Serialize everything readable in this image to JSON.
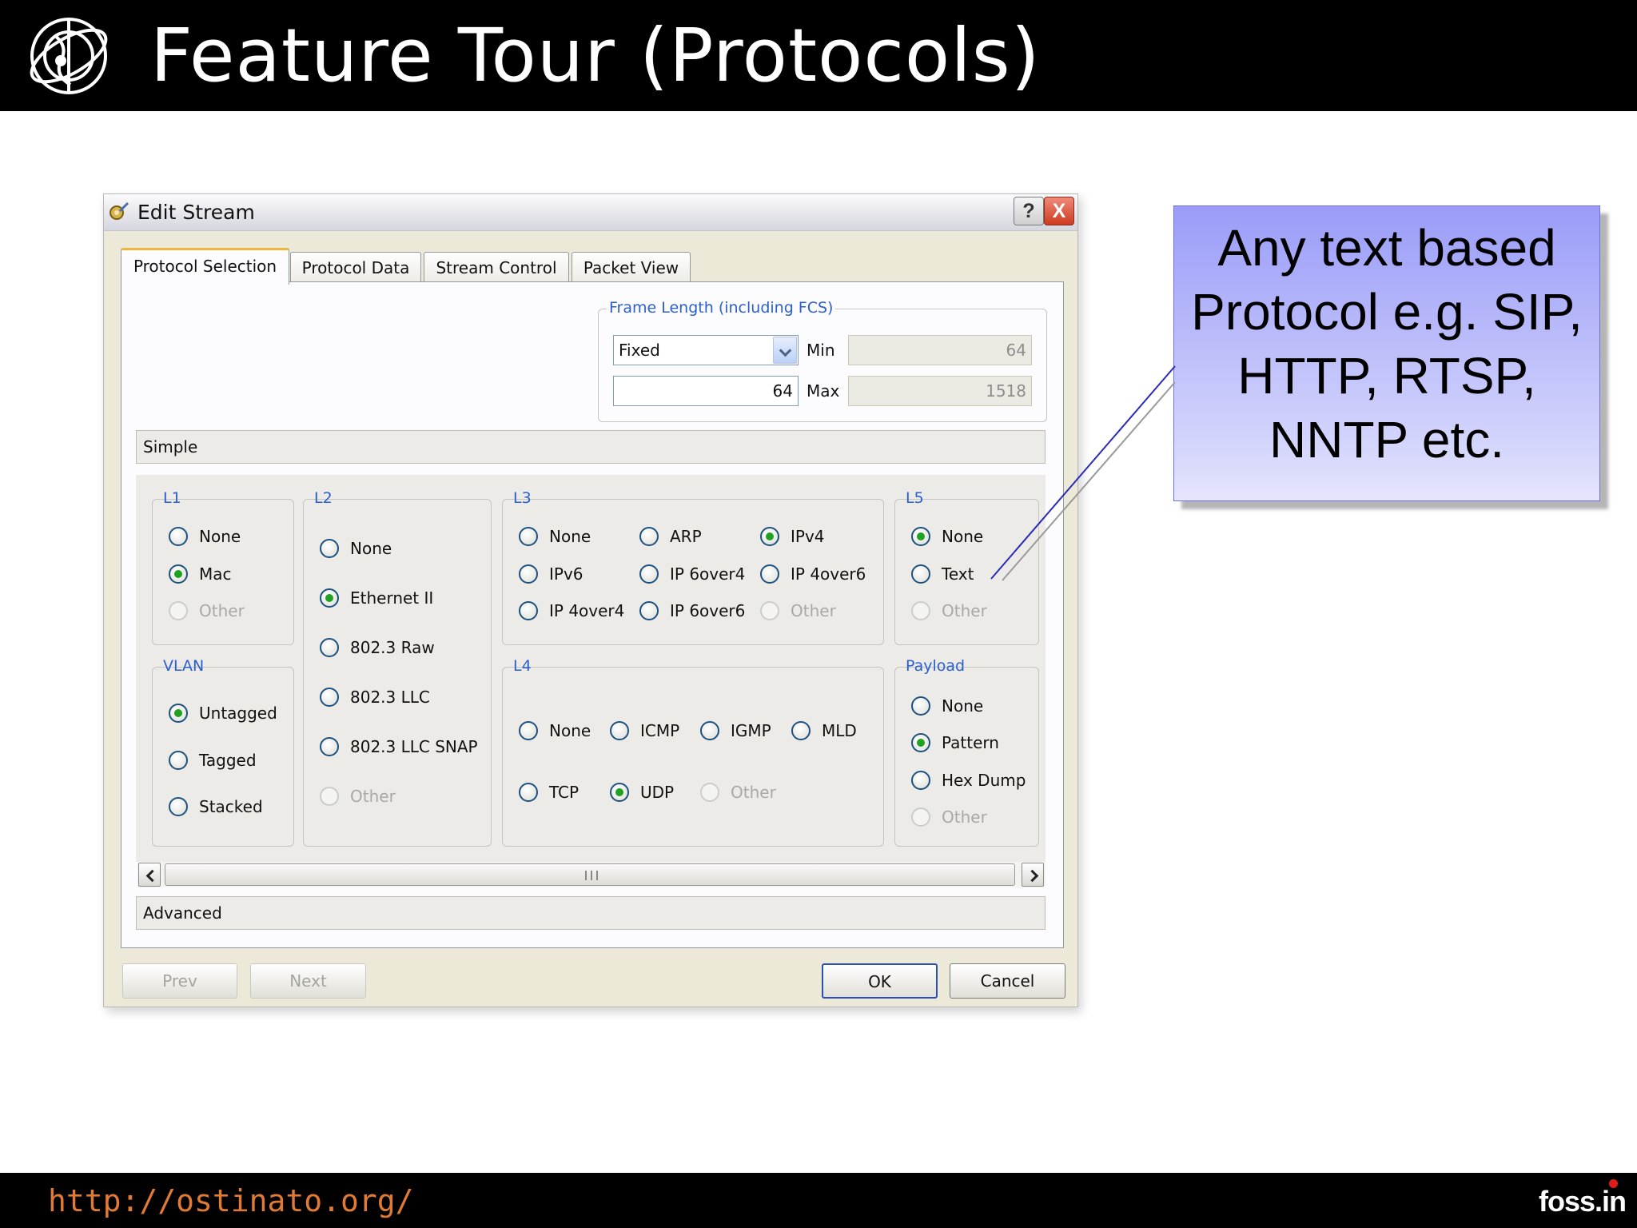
{
  "slide": {
    "title": "Feature Tour (Protocols)",
    "footer_url": "http://ostinato.org/",
    "footer_logo": "foss.in"
  },
  "dialog": {
    "title": "Edit Stream",
    "help_label": "?",
    "close_label": "X",
    "tabs": [
      "Protocol Selection",
      "Protocol Data",
      "Stream Control",
      "Packet View"
    ],
    "frame_length": {
      "label": "Frame Length (including FCS)",
      "mode": "Fixed",
      "value": "64",
      "min_label": "Min",
      "min_value": "64",
      "max_label": "Max",
      "max_value": "1518"
    },
    "simple_label": "Simple",
    "advanced_label": "Advanced",
    "groups": {
      "l1": {
        "label": "L1",
        "options": [
          "None",
          "Mac",
          "Other"
        ],
        "selected": "Mac",
        "disabled": [
          "Other"
        ]
      },
      "vlan": {
        "label": "VLAN",
        "options": [
          "Untagged",
          "Tagged",
          "Stacked"
        ],
        "selected": "Untagged"
      },
      "l2": {
        "label": "L2",
        "options": [
          "None",
          "Ethernet II",
          "802.3 Raw",
          "802.3 LLC",
          "802.3 LLC SNAP",
          "Other"
        ],
        "selected": "Ethernet II",
        "disabled": [
          "Other"
        ]
      },
      "l3": {
        "label": "L3",
        "options": [
          "None",
          "ARP",
          "IPv4",
          "IPv6",
          "IP 6over4",
          "IP 4over6",
          "IP 4over4",
          "IP 6over6",
          "Other"
        ],
        "selected": "IPv4",
        "disabled": [
          "Other"
        ]
      },
      "l4": {
        "label": "L4",
        "options": [
          "None",
          "ICMP",
          "IGMP",
          "MLD",
          "TCP",
          "UDP",
          "Other"
        ],
        "selected": "UDP",
        "disabled": [
          "Other"
        ]
      },
      "l5": {
        "label": "L5",
        "options": [
          "None",
          "Text",
          "Other"
        ],
        "selected": "None",
        "disabled": [
          "Other"
        ]
      },
      "payload": {
        "label": "Payload",
        "options": [
          "None",
          "Pattern",
          "Hex Dump",
          "Other"
        ],
        "selected": "Pattern",
        "disabled": [
          "Other"
        ]
      }
    },
    "buttons": {
      "prev": "Prev",
      "next": "Next",
      "ok": "OK",
      "cancel": "Cancel"
    }
  },
  "callout": {
    "lines": [
      "Any text based",
      "Protocol e.g. SIP,",
      "HTTP, RTSP,",
      "NNTP etc."
    ]
  },
  "colors": {
    "header_bg": "#000000",
    "footer_url": "#e07a35",
    "group_label": "#2a5fd0",
    "radio_checked": "#21a121",
    "callout_top": "#9a9cf8",
    "callout_bottom": "#e5e6fd"
  },
  "icons": {
    "logo": "ostinato-logo-icon",
    "title": "edit-stream-icon",
    "scroll_left": "arrow-left-icon",
    "scroll_right": "arrow-right-icon"
  }
}
